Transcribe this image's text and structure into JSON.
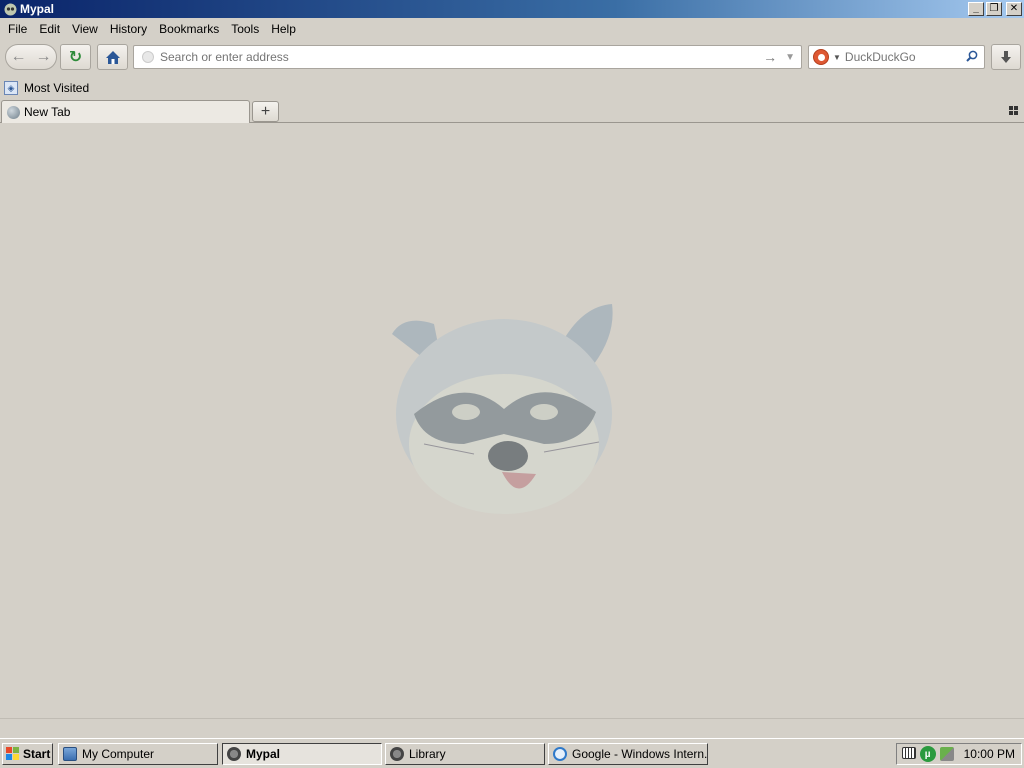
{
  "window": {
    "title": "Mypal"
  },
  "menu": {
    "items": [
      "File",
      "Edit",
      "View",
      "History",
      "Bookmarks",
      "Tools",
      "Help"
    ]
  },
  "navbar": {
    "url_placeholder": "Search or enter address",
    "search_engine": "DuckDuckGo",
    "search_placeholder": "DuckDuckGo"
  },
  "bookmarks": {
    "items": [
      {
        "label": "Most Visited",
        "icon": "bookmark-folder-icon"
      }
    ]
  },
  "tabs": [
    {
      "label": "New Tab",
      "active": true
    }
  ],
  "taskbar": {
    "start_label": "Start",
    "tasks": [
      {
        "label": "My Computer",
        "icon": "computer-icon",
        "active": false
      },
      {
        "label": "Mypal",
        "icon": "raccoon-icon",
        "active": true
      },
      {
        "label": "Library",
        "icon": "raccoon-icon",
        "active": false
      },
      {
        "label": "Google - Windows Intern...",
        "icon": "ie-icon",
        "active": false
      }
    ],
    "clock": "10:00 PM"
  },
  "colors": {
    "titlebar_start": "#0a246a",
    "titlebar_end": "#a6caf0",
    "chrome": "#d4d0c8",
    "ddg": "#de5833"
  }
}
